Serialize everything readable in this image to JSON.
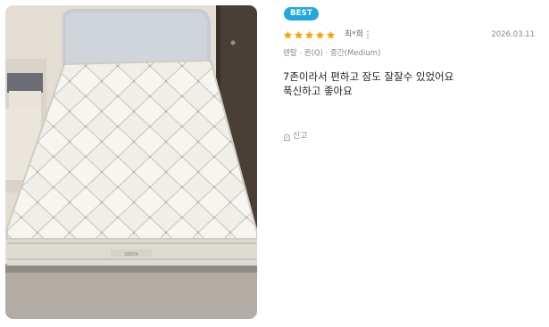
{
  "review": {
    "badge": "BEST",
    "rating": 5,
    "rating_max": 5,
    "reviewer": "최*희",
    "date": "2026.03.11",
    "option": "렌탈 · 퀸(Q) · 중간(Medium)",
    "body_lines": [
      "7존이라서 편하고 잠도 잘잘수 있었어요",
      "푹신하고 좋아요"
    ],
    "report_label": "신고",
    "photo_brand_label": "SERTA"
  },
  "icons": {
    "star": "star-icon",
    "more": "more-vertical-icon",
    "report": "siren-icon"
  },
  "colors": {
    "badge_bg": "#20a8e0",
    "star": "#f7a600",
    "muted_text": "#888888"
  }
}
